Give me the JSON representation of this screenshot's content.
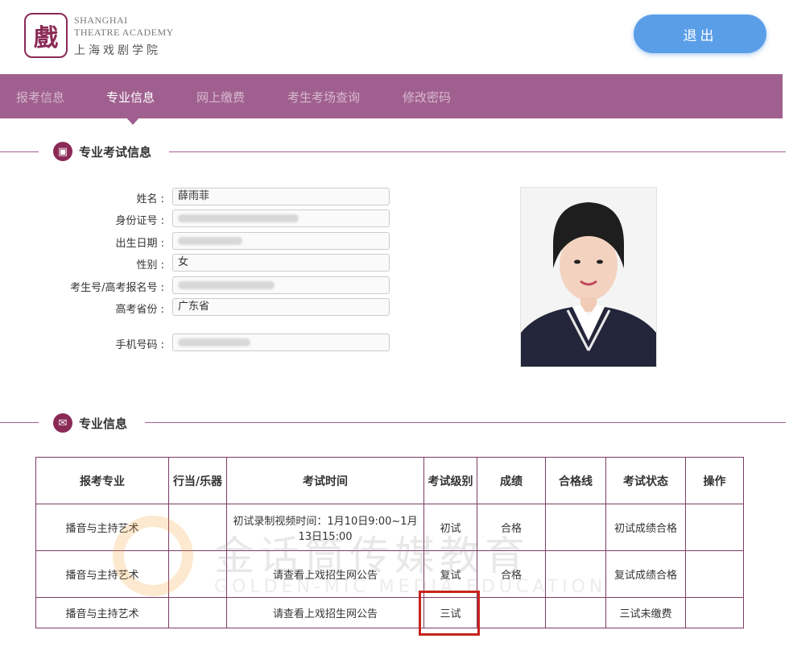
{
  "header": {
    "logo_en_line1": "Shanghai",
    "logo_en_line2": "Theatre Academy",
    "logo_cn": "上海戏剧学院",
    "logout_label": "退出"
  },
  "nav": {
    "items": [
      "报考信息",
      "专业信息",
      "网上缴费",
      "考生考场查询",
      "修改密码"
    ],
    "active_index": 1
  },
  "profile_section": {
    "title": "专业考试信息",
    "fields": [
      {
        "label": "姓名 :",
        "value": "薛雨菲"
      },
      {
        "label": "身份证号 :",
        "value": ""
      },
      {
        "label": "出生日期 :",
        "value": ""
      },
      {
        "label": "性别 :",
        "value": "女"
      },
      {
        "label": "考生号/高考报名号 :",
        "value": ""
      },
      {
        "label": "高考省份 :",
        "value": "广东省"
      },
      {
        "label": "手机号码 :",
        "value": ""
      }
    ]
  },
  "major_section": {
    "title": "专业信息",
    "headers": [
      "报考专业",
      "行当/乐器",
      "考试时间",
      "考试级别",
      "成绩",
      "合格线",
      "考试状态",
      "操作"
    ],
    "rows": [
      {
        "major": "播音与主持艺术",
        "role": "",
        "time": "初试录制视频时间：1月10日9:00~1月13日15:00",
        "level": "初试",
        "score": "合格",
        "line": "",
        "status": "初试成绩合格",
        "action": ""
      },
      {
        "major": "播音与主持艺术",
        "role": "",
        "time": "请查看上戏招生网公告",
        "level": "复试",
        "score": "合格",
        "line": "",
        "status": "复试成绩合格",
        "action": ""
      },
      {
        "major": "播音与主持艺术",
        "role": "",
        "time": "请查看上戏招生网公告",
        "level": "三试",
        "score": "",
        "line": "",
        "status": "三试未缴费",
        "action": ""
      }
    ]
  },
  "watermark": {
    "cn": "金话筒传媒教育",
    "en": "GOLDEN-MIC MEDIA EDUCATION"
  },
  "colors": {
    "nav_bg": "#a0608f",
    "accent": "#8a2a55",
    "logout_bg": "#5b9ee8",
    "highlight_box": "#c8231e"
  }
}
